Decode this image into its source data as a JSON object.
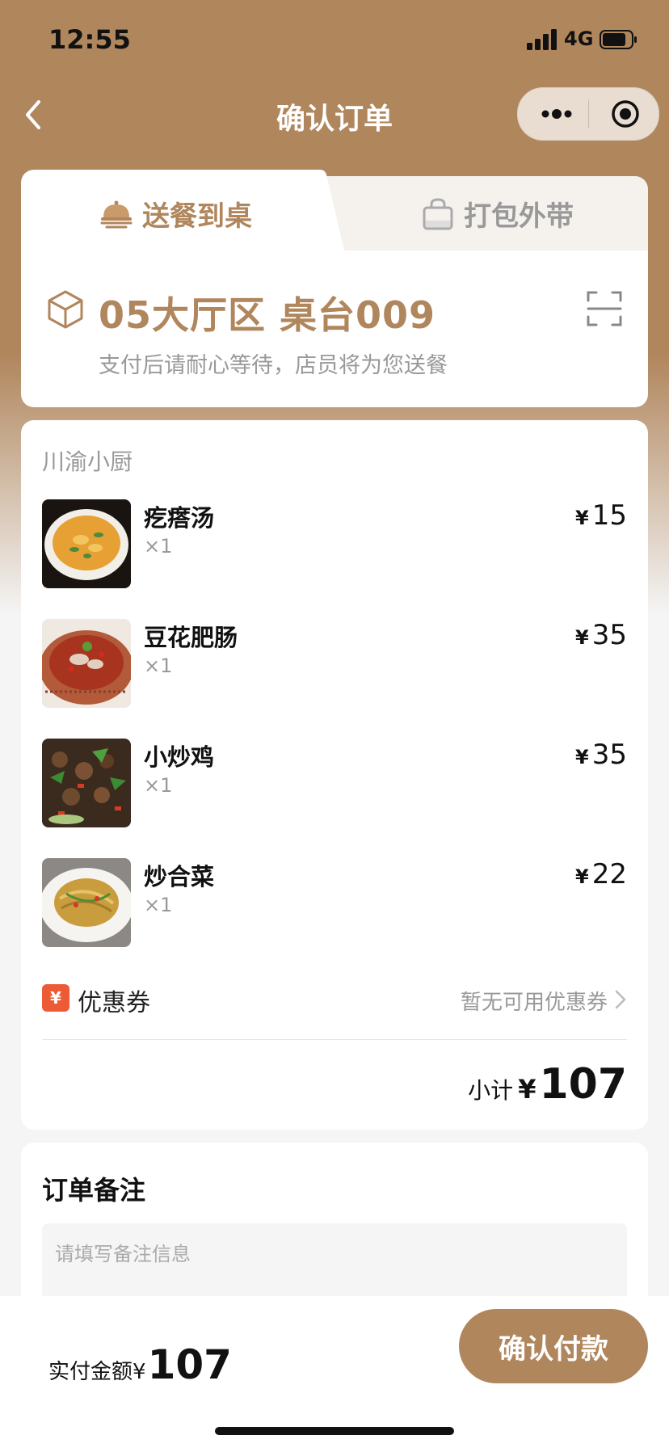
{
  "status_bar": {
    "time": "12:55",
    "network": "4G"
  },
  "nav": {
    "title": "确认订单"
  },
  "tabs": [
    {
      "label": "送餐到桌",
      "icon": "dining-cloche-icon",
      "active": true
    },
    {
      "label": "打包外带",
      "icon": "takeaway-bag-icon",
      "active": false
    }
  ],
  "table": {
    "name": "05大厅区 桌台009",
    "subtitle": "支付后请耐心等待，店员将为您送餐"
  },
  "order": {
    "shop_name": "川渝小厨",
    "items": [
      {
        "name": "疙瘩汤",
        "qty": "×1",
        "price": "15",
        "currency": "¥"
      },
      {
        "name": "豆花肥肠",
        "qty": "×1",
        "price": "35",
        "currency": "¥"
      },
      {
        "name": "小炒鸡",
        "qty": "×1",
        "price": "35",
        "currency": "¥"
      },
      {
        "name": "炒合菜",
        "qty": "×1",
        "price": "22",
        "currency": "¥"
      }
    ],
    "coupon": {
      "badge": "¥",
      "label": "优惠券",
      "status": "暂无可用优惠券"
    },
    "subtotal": {
      "label": "小计",
      "currency": "¥",
      "amount": "107"
    }
  },
  "remark": {
    "title": "订单备注",
    "placeholder": "请填写备注信息"
  },
  "bottom": {
    "pay_label": "实付金额",
    "currency": "¥",
    "amount": "107",
    "confirm_button": "确认付款"
  },
  "colors": {
    "brand": "#b0865d",
    "coupon_badge": "#ec5a36",
    "background": "#f5f5f5"
  }
}
